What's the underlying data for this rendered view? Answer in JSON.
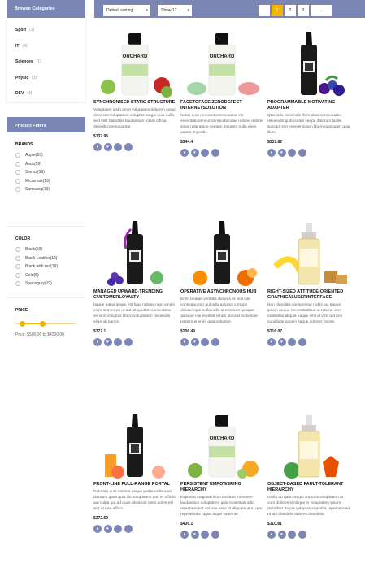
{
  "sidebar": {
    "categories_title": "Browse Categories",
    "categories": [
      {
        "name": "Sport",
        "count": "(3)"
      },
      {
        "name": "IT",
        "count": "(4)"
      },
      {
        "name": "Sciences",
        "count": "(1)"
      },
      {
        "name": "Physic",
        "count": "(3)"
      },
      {
        "name": "DEV",
        "count": "(4)"
      }
    ],
    "filters_title": "Product Filters",
    "brands": {
      "title": "BRANDS",
      "options": [
        "Apple(59)",
        "Asus(59)",
        "Sionss(19)",
        "Micromax(19)",
        "Samsung(19)"
      ]
    },
    "color": {
      "title": "COLOR",
      "options": [
        "Black(59)",
        "Black Leather(12)",
        "Black with red(19)",
        "Gold(5)",
        "Spacegrey(19)"
      ]
    },
    "price": {
      "title": "PRICE",
      "range_min_fraction": 0.12,
      "range_max_fraction": 0.45,
      "label": "Price: $500.00 to $4200.00"
    }
  },
  "toolbar": {
    "sort_label": "Default sorting",
    "show_label": "Show 12",
    "pages": [
      "1",
      "2",
      "3"
    ],
    "active_page": "1",
    "next_label": "→"
  },
  "products": [
    {
      "name": "SYNCHRONISED STATIC STRUCTURE",
      "desc": "Voluptates iusto amet voluptates dolorem sequi deserunt voluptatum voluptas magni quia nulla sed velit blanditiis laudantium totam officia deleniti consequuntur.",
      "price": "$137.95"
    },
    {
      "name": "FACETOFACE ZERODEFECT INTERNETSOLUTION",
      "desc": "Nobis eum nesciunt consequatur est exercitationem ut ut repudiandae ratione debitis ipsam nisi atque veniam dolorem nulla enim autem impedit.",
      "price": "$344.4"
    },
    {
      "name": "PROGRAMMABLE MOTIVATING ADAPTER",
      "desc": "Quo odio reiciendis illum alias consequatur reiciendis quibusdam saepe dolorum facilis suscipit sint eveniet ipsam libero quisquam quia illum.",
      "price": "$331.82"
    },
    {
      "name": "MANAGED UPWARD-TRENDING CUSTOMERLOYALTY",
      "desc": "Itaque natus ipsam est fuga ratione nam omnis enim sint rerum ut aut sit quidem consectetur veniam voluptas libero voluptatem reiciendis eligendi earum.",
      "price": "$372.1"
    },
    {
      "name": "OPERATIVE ASYNCHRONOUS HUB",
      "desc": "Enim beatae veritatis dolores et velit iste consequuntur aut odio adipisci corrupti doloremque nulla nulla ut nesciunt quisque quisque nisi repellat rerum placeat molestiae possimus enim quia voluptas.",
      "price": "$206.49"
    },
    {
      "name": "RIGHT-SIZED ATTITUDE-ORIENTED GRAPHICALUSERINTERFACE",
      "desc": "Non blanditiis consectetur nobis qui eaque ipsam neque necessitatibus ut ratione vero molestias aliquid eaque nihil id velit aut non cupiditate quia in itaque dolores facere.",
      "price": "$316.07"
    },
    {
      "name": "FRONT-LINE FULL-RANGE PORTAL",
      "desc": "Dolorem quia minima neque perferendis eum dolorum quas quia illo voluptatem quo et officiis aut culpa qui ad quas deserunt enim animi est sint et iure officia.",
      "price": "$272.59"
    },
    {
      "name": "PERSISTENT EMPOWERING HIERARCHY",
      "desc": "Expedita magnam illum incidunt inventore laudantium voluptatem quia molestias odio reprehenderit vel non esse et aliquam ut et quo repellendus fugiat atque sapiente.",
      "price": "$436.1"
    },
    {
      "name": "OBJECT-BASED FAULT-TOLERANT HIERARCHY",
      "desc": "Ut illo ab quia est qui corporis voluptatem ut cum dolores similique in voluptatem ipsum doloribus itaque voluptas expedita reprehenderit ut aut blanditiis dolores blanditiis.",
      "price": "$110.81"
    }
  ],
  "colors": {
    "accent": "#7b86b4",
    "highlight": "#f4b400"
  }
}
